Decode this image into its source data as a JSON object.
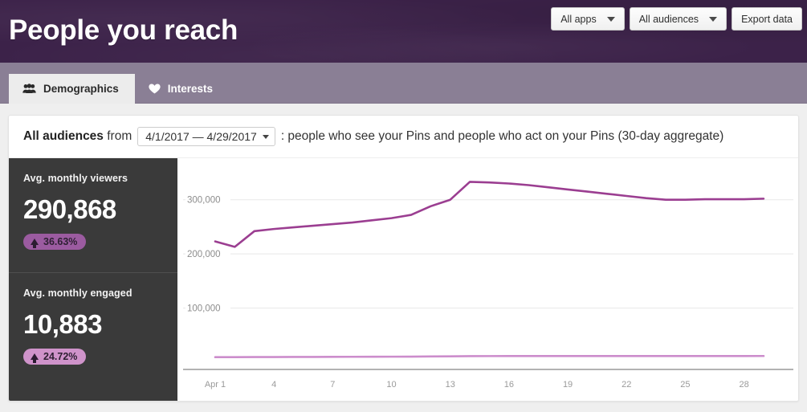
{
  "header": {
    "title": "People you reach",
    "buttons": [
      {
        "name": "all-apps",
        "label": "All apps",
        "has_caret": true
      },
      {
        "name": "all-audiences",
        "label": "All audiences",
        "has_caret": true
      },
      {
        "name": "export-data",
        "label": "Export data",
        "has_caret": false
      }
    ]
  },
  "tabs": [
    {
      "label": "Demographics",
      "icon": "people-group-icon",
      "active": true
    },
    {
      "label": "Interests",
      "icon": "heart-icon",
      "active": false
    }
  ],
  "filter": {
    "audience": "All audiences",
    "from_word": "from",
    "date_range": "4/1/2017 — 4/29/2017",
    "description": ": people who see your Pins and people who act on your Pins (30-day aggregate)"
  },
  "stats": [
    {
      "label": "Avg. monthly viewers",
      "value": "290,868",
      "change": "36.63%",
      "direction": "up",
      "badge_color": "#9b5ba0",
      "badge_text_color": "#2e2033"
    },
    {
      "label": "Avg. monthly engaged",
      "value": "10,883",
      "change": "24.72%",
      "direction": "up",
      "badge_color": "#cf93ca",
      "badge_text_color": "#2e2033"
    }
  ],
  "colors": {
    "header_purple": "#3c2249",
    "tabbar_purple": "#8a7f95",
    "stats_dark": "#3a3a3a",
    "viewers_line": "#9b3e91",
    "engaged_line": "#cc8dcc",
    "gridline": "#e8e8e8",
    "axis": "#8d8d8d"
  },
  "chart_data": {
    "type": "line",
    "title": "",
    "xlabel": "",
    "ylabel": "",
    "grid": true,
    "legend": "none",
    "ylim": [
      0,
      350000
    ],
    "yticks": [
      100000,
      200000,
      300000
    ],
    "ytick_labels": [
      "100,000",
      "200,000",
      "300,000"
    ],
    "x": [
      1,
      2,
      3,
      4,
      5,
      6,
      7,
      8,
      9,
      10,
      11,
      12,
      13,
      14,
      15,
      16,
      17,
      18,
      19,
      20,
      21,
      22,
      23,
      24,
      25,
      26,
      27,
      28,
      29
    ],
    "xtick_positions": [
      1,
      4,
      7,
      10,
      13,
      16,
      19,
      22,
      25,
      28
    ],
    "xtick_labels": [
      "Apr 1",
      "4",
      "7",
      "10",
      "13",
      "16",
      "19",
      "22",
      "25",
      "28"
    ],
    "series": [
      {
        "name": "Avg. monthly viewers",
        "color": "#9b3e91",
        "values": [
          223000,
          213000,
          242000,
          246000,
          249000,
          252000,
          255000,
          258000,
          262000,
          266000,
          272000,
          288000,
          300000,
          333000,
          332000,
          330000,
          327000,
          323000,
          319000,
          315000,
          311000,
          307000,
          303000,
          300000,
          300000,
          301000,
          301000,
          301000,
          302000
        ]
      },
      {
        "name": "Avg. monthly engaged",
        "color": "#cc8dcc",
        "values": [
          9300,
          9400,
          9500,
          9600,
          9700,
          9800,
          9900,
          10000,
          10100,
          10200,
          10300,
          10600,
          10900,
          11200,
          11300,
          11350,
          11400,
          11400,
          11400,
          11400,
          11400,
          11400,
          11400,
          11400,
          11400,
          11400,
          11450,
          11450,
          11500
        ]
      }
    ]
  }
}
